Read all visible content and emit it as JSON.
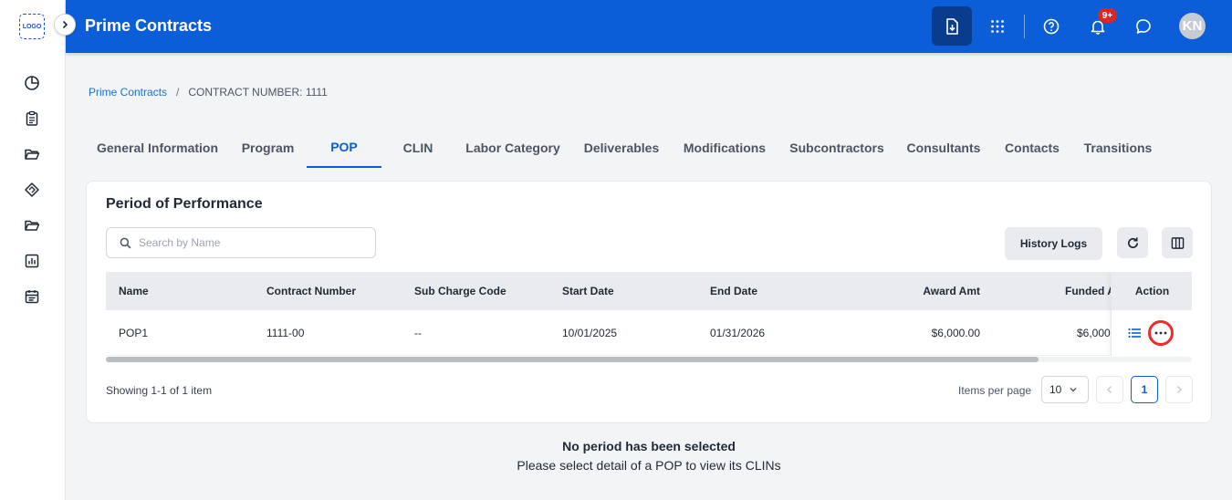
{
  "app": {
    "logo_text": "LOGO",
    "title": "Prime Contracts"
  },
  "topbar": {
    "notification_badge": "9+",
    "avatar_initials": "KN"
  },
  "breadcrumb": {
    "parent": "Prime Contracts",
    "separator": "/",
    "current": "CONTRACT NUMBER: 1111"
  },
  "tabs": [
    {
      "label": "General Information"
    },
    {
      "label": "Program"
    },
    {
      "label": "POP",
      "active": true
    },
    {
      "label": "CLIN"
    },
    {
      "label": "Labor Category"
    },
    {
      "label": "Deliverables"
    },
    {
      "label": "Modifications"
    },
    {
      "label": "Subcontractors"
    },
    {
      "label": "Consultants"
    },
    {
      "label": "Contacts"
    },
    {
      "label": "Transitions"
    }
  ],
  "card": {
    "title": "Period of Performance",
    "search_placeholder": "Search by Name",
    "history_button": "History Logs"
  },
  "table": {
    "columns": [
      "Name",
      "Contract Number",
      "Sub Charge Code",
      "Start Date",
      "End Date",
      "Award Amt",
      "Funded Amt",
      "Action"
    ],
    "visible_funded_header": "Funded A",
    "rows": [
      {
        "name": "POP1",
        "contract_number": "1111-00",
        "sub_charge_code": "--",
        "start_date": "10/01/2025",
        "end_date": "01/31/2026",
        "award_amt": "$6,000.00",
        "funded_amt": "$6,000"
      }
    ]
  },
  "pagination": {
    "showing": "Showing 1-1 of 1 item",
    "items_per_page_label": "Items per page",
    "items_per_page_value": "10",
    "current_page": "1"
  },
  "empty_state": {
    "title": "No period has been selected",
    "subtitle": "Please select detail of a POP to view its CLINs"
  },
  "colors": {
    "primary": "#0b5ed7",
    "primary_dark": "#093c8c",
    "badge": "#dc2626",
    "highlight": "#ef2b2b"
  }
}
